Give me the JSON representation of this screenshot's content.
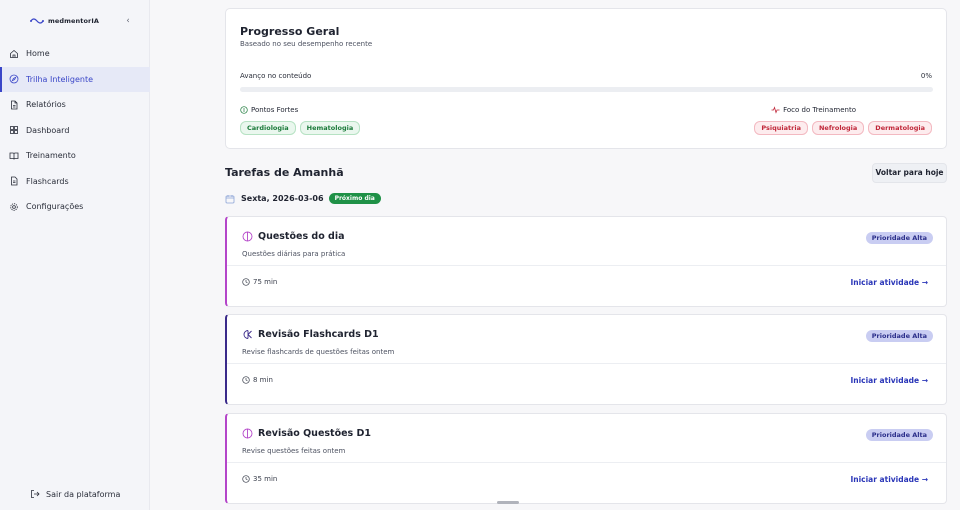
{
  "app": {
    "logo_text": "medmentorIA",
    "collapse_glyph": "‹"
  },
  "sidebar": {
    "items": [
      {
        "label": "Home",
        "icon": "home-icon"
      },
      {
        "label": "Trilha Inteligente",
        "icon": "compass-icon",
        "active": true
      },
      {
        "label": "Relatórios",
        "icon": "document-icon"
      },
      {
        "label": "Dashboard",
        "icon": "grid-icon"
      },
      {
        "label": "Treinamento",
        "icon": "book-icon"
      },
      {
        "label": "Flashcards",
        "icon": "cards-icon"
      },
      {
        "label": "Configurações",
        "icon": "gear-icon"
      }
    ],
    "logout_label": "Sair da plataforma"
  },
  "progress": {
    "title": "Progresso Geral",
    "subtitle": "Baseado no seu desempenho recente",
    "advance_label": "Avanço no conteúdo",
    "advance_value": "0%",
    "advance_fraction": 0,
    "strengths_label": "Pontos Fortes",
    "strengths": [
      "Cardiologia",
      "Hematologia"
    ],
    "focus_label": "Foco do Treinamento",
    "focus": [
      "Psiquiatria",
      "Nefrologia",
      "Dermatologia"
    ]
  },
  "tasks": {
    "title": "Tarefas de Amanhã",
    "back_button": "Voltar para hoje",
    "date": "Sexta, 2026-03-06",
    "date_badge": "Próximo dia",
    "items": [
      {
        "title": "Questões do dia",
        "description": "Questões diárias para prática",
        "priority": "Prioridade Alta",
        "duration": "75 min",
        "action": "Iniciar atividade →"
      },
      {
        "title": "Revisão Flashcards D1",
        "description": "Revise flashcards de questões feitas ontem",
        "priority": "Prioridade Alta",
        "duration": "8 min",
        "action": "Iniciar atividade →"
      },
      {
        "title": "Revisão Questões D1",
        "description": "Revise questões feitas ontem",
        "priority": "Prioridade Alta",
        "duration": "35 min",
        "action": "Iniciar atividade →"
      }
    ]
  },
  "colors": {
    "accent": "#3a46c8",
    "strength": "#1b7a3a",
    "focus": "#c0283a",
    "task_border_pink": "#b445c9",
    "task_border_indigo": "#3a2a8a"
  }
}
